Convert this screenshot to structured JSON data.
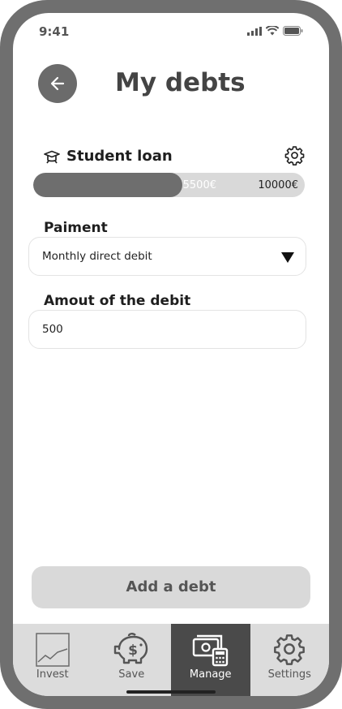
{
  "status": {
    "time": "9:41"
  },
  "header": {
    "title": "My debts",
    "back_icon": "arrow-left-icon"
  },
  "debt": {
    "name": "Student loan",
    "current": "5500€",
    "total": "10000€",
    "progress_fraction": 0.55
  },
  "payment": {
    "label": "Paiment",
    "selected": "Monthly direct debit"
  },
  "amount": {
    "label": "Amout of the debit",
    "value": "500"
  },
  "actions": {
    "add_label": "Add a debt"
  },
  "tabs": [
    {
      "label": "Invest",
      "icon": "chart-icon",
      "active": false
    },
    {
      "label": "Save",
      "icon": "piggy-bank-icon",
      "active": false
    },
    {
      "label": "Manage",
      "icon": "money-calculator-icon",
      "active": true
    },
    {
      "label": "Settings",
      "icon": "gear-icon",
      "active": false
    }
  ],
  "colors": {
    "frame": "#6f6f6f",
    "accent": "#6e6e6e",
    "track": "#d9d9d9",
    "active_tab": "#4a4a4a"
  }
}
